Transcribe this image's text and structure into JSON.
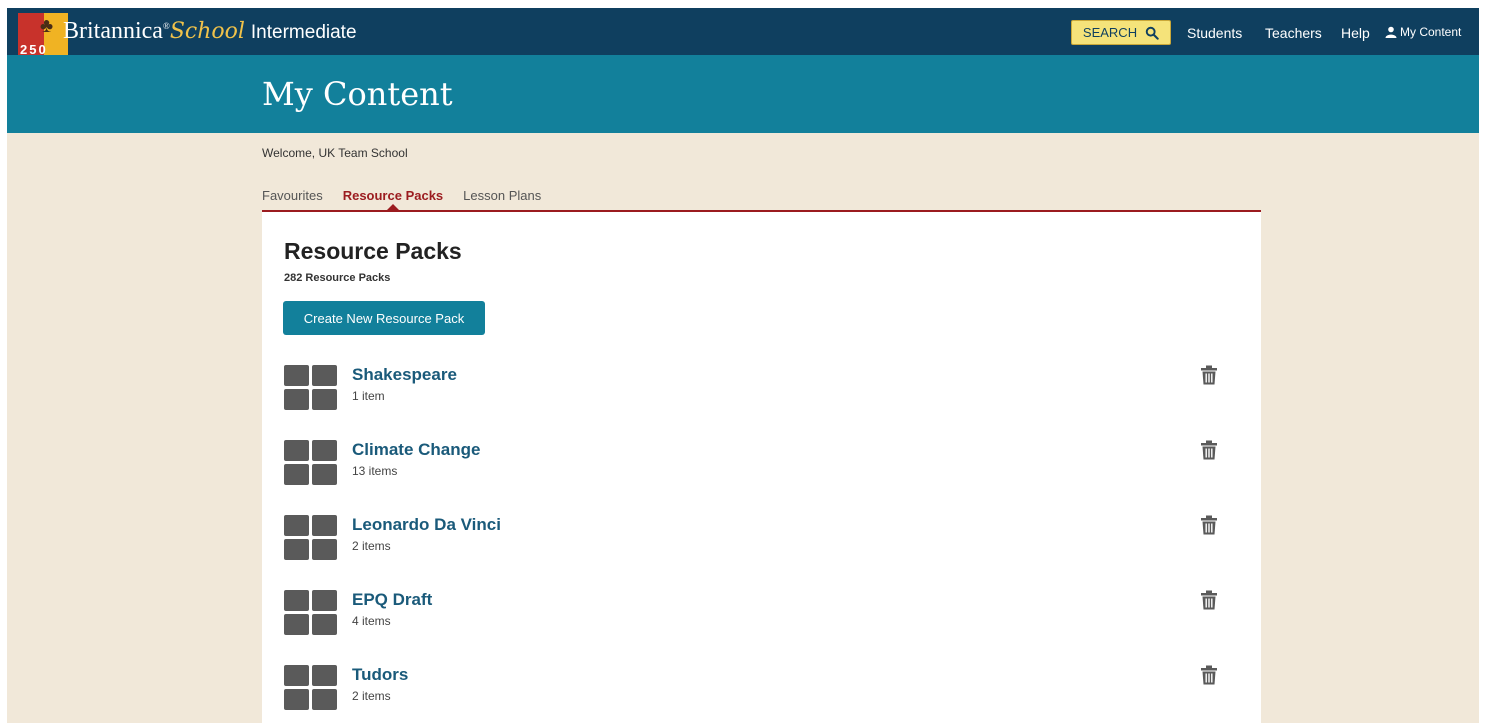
{
  "header": {
    "logo_badge_number": "250",
    "brand_name": "Britannica",
    "brand_school": "School",
    "brand_tier": "Intermediate",
    "search_label": "SEARCH",
    "nav": {
      "students": "Students",
      "teachers": "Teachers",
      "help": "Help",
      "my_content": "My Content"
    }
  },
  "page": {
    "title": "My Content",
    "welcome": "Welcome, UK Team School"
  },
  "tabs": [
    {
      "label": "Favourites",
      "active": false
    },
    {
      "label": "Resource Packs",
      "active": true
    },
    {
      "label": "Lesson Plans",
      "active": false
    }
  ],
  "panel": {
    "title": "Resource Packs",
    "count": "282 Resource Packs",
    "create_label": "Create New Resource Pack"
  },
  "packs": [
    {
      "name": "Shakespeare",
      "items": "1 item"
    },
    {
      "name": "Climate Change",
      "items": "13 items"
    },
    {
      "name": "Leonardo Da Vinci",
      "items": "2 items"
    },
    {
      "name": "EPQ Draft",
      "items": "4 items"
    },
    {
      "name": "Tudors",
      "items": "2 items"
    }
  ],
  "colors": {
    "topbar": "#0f3f5f",
    "titlebar": "#12809b",
    "background": "#f1e8d9",
    "accent_red": "#9b1b1f",
    "search_yellow": "#f5e37a",
    "pack_link": "#1a5a7a"
  },
  "icons": {
    "search": "search-icon",
    "user": "user-icon",
    "trash": "trash-icon",
    "pack_thumbnail": "grid-thumbnail-icon"
  }
}
